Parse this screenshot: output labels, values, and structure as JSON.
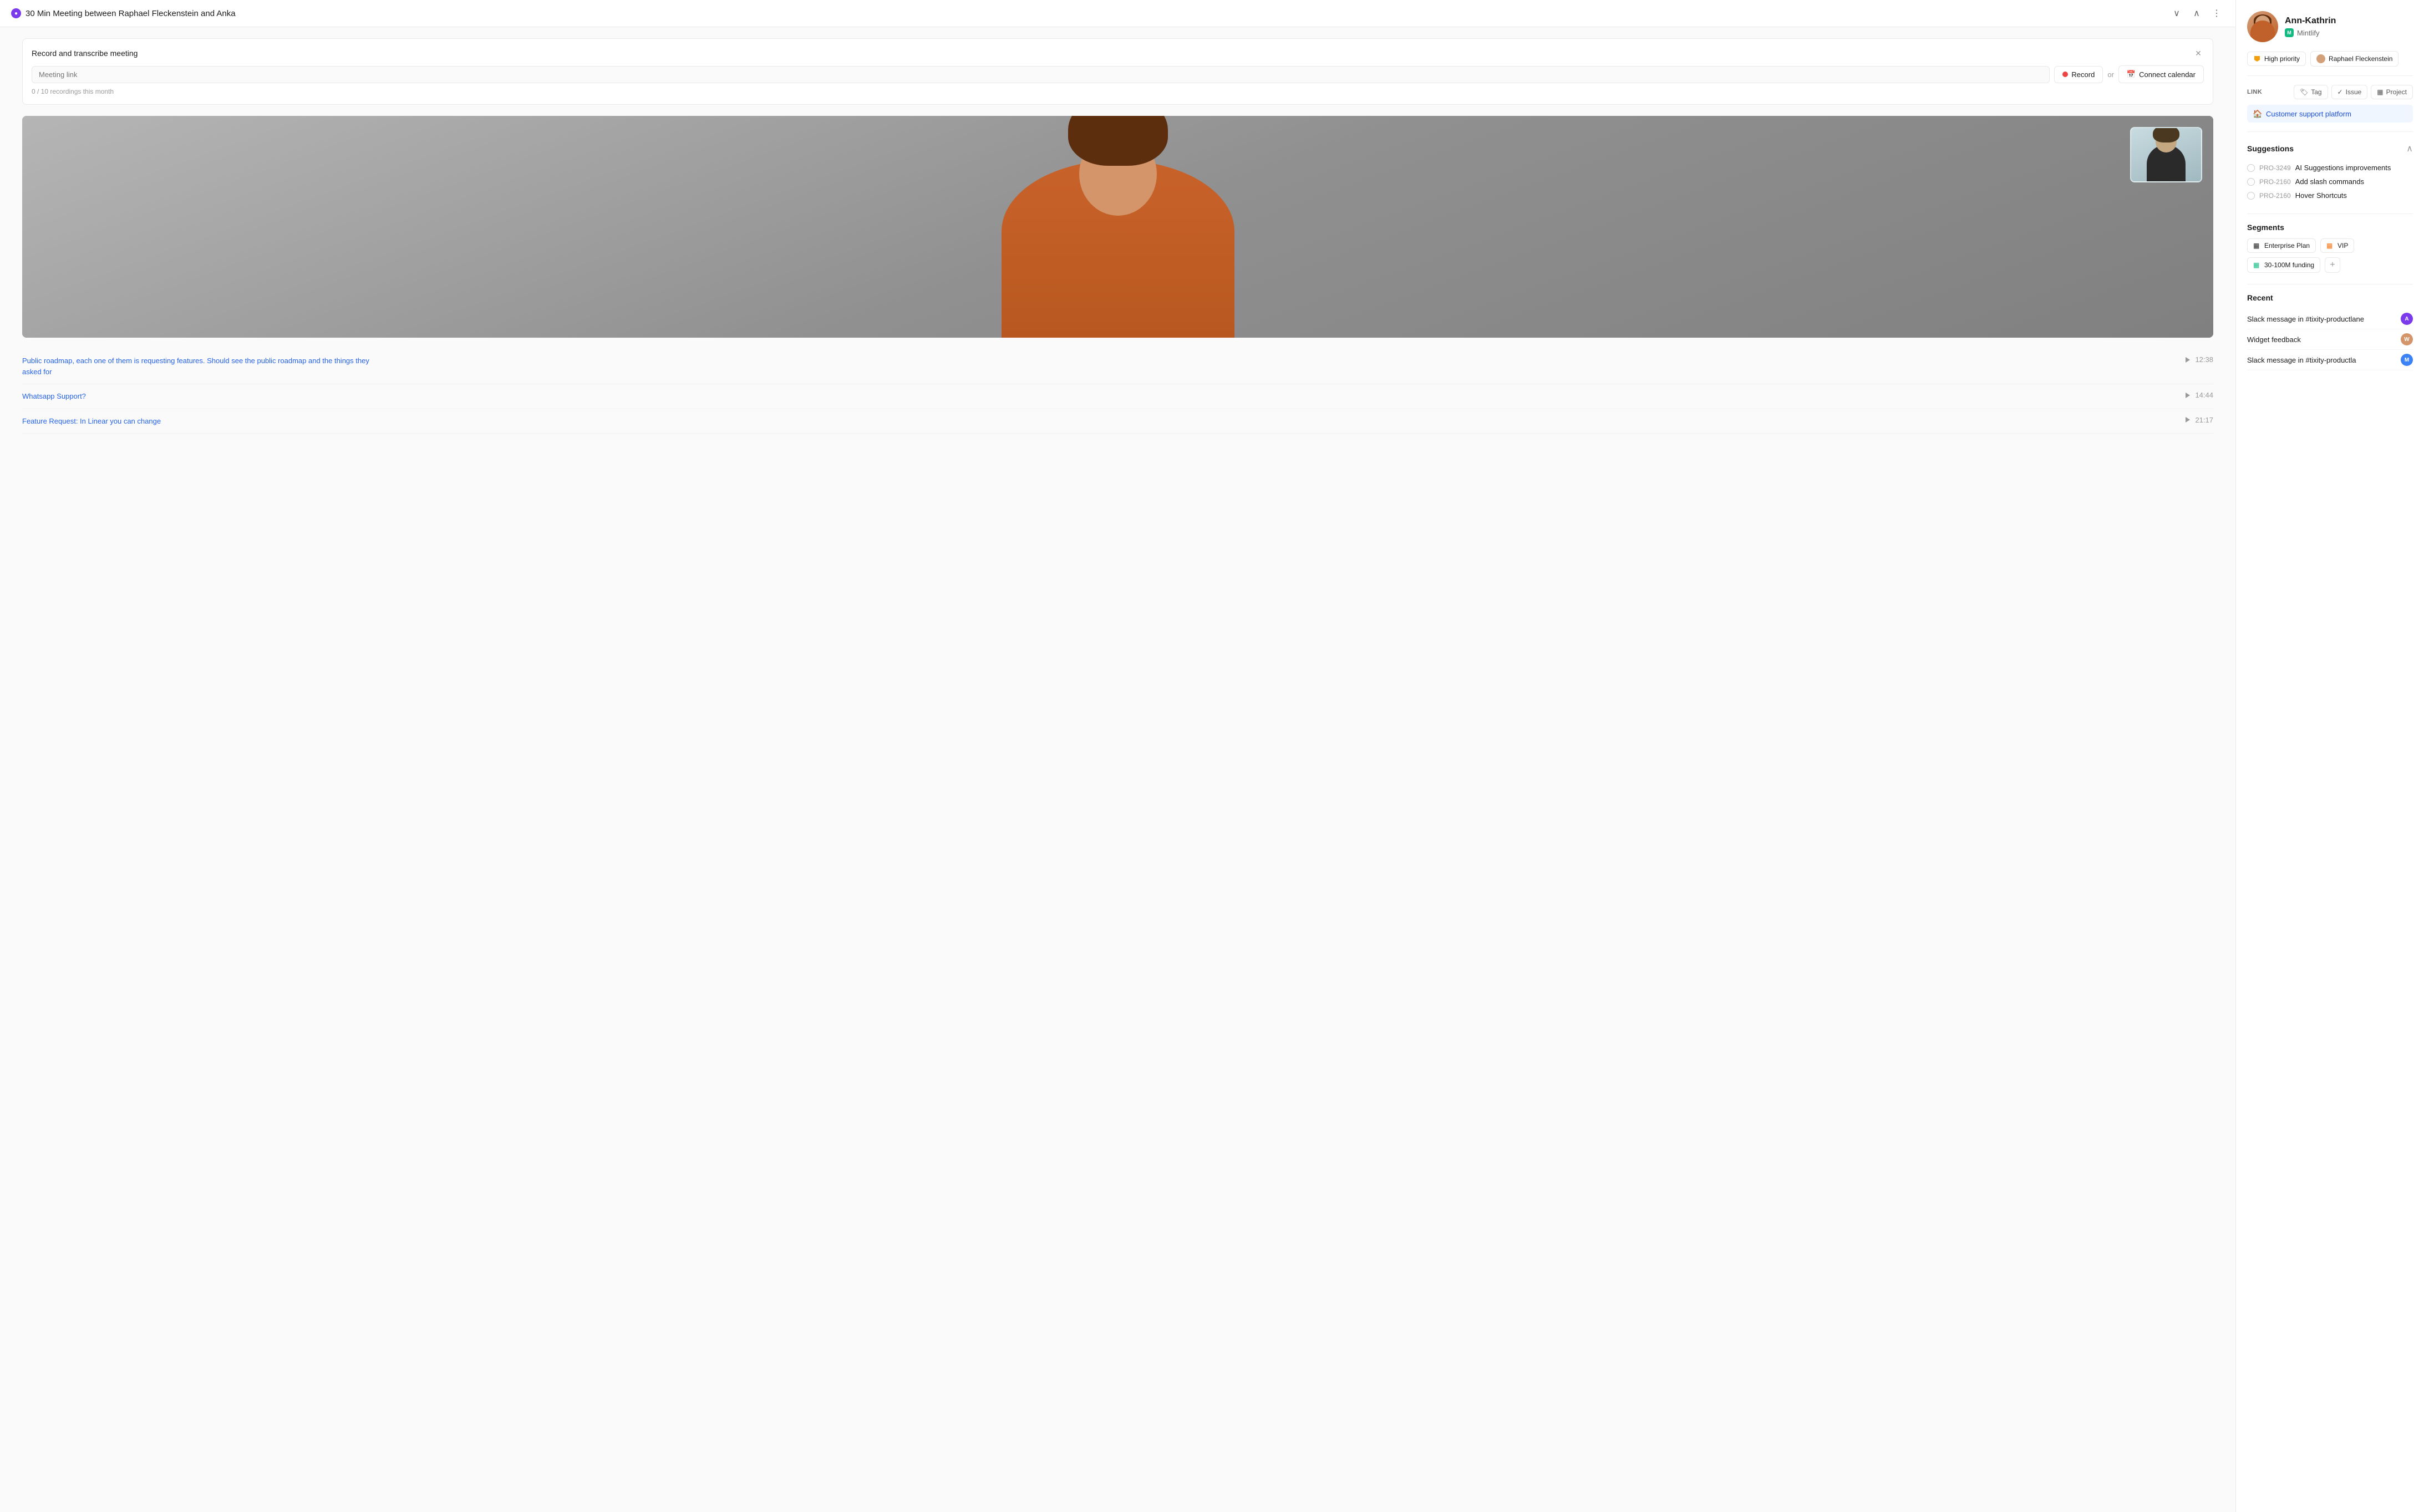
{
  "header": {
    "title": "30 Min Meeting between Raphael Fleckenstein and  Anka",
    "icon": "●",
    "collapse_label": "∨",
    "expand_label": "∧",
    "more_label": "⋮"
  },
  "record_card": {
    "title": "Record and transcribe meeting",
    "meeting_link_placeholder": "Meeting link",
    "record_label": "Record",
    "or_text": "or",
    "connect_calendar_label": "Connect calendar",
    "recordings_count": "0 / 10 recordings this month",
    "close_label": "✕"
  },
  "transcript": {
    "items": [
      {
        "text": "Public roadmap, each one of them is requesting features. Should see the public roadmap and the things they asked for",
        "time": "12:38"
      },
      {
        "text": "Whatsapp Support?",
        "time": "14:44"
      },
      {
        "text": "Feature Request: In Linear you can change",
        "time": "21:17"
      }
    ]
  },
  "sidebar": {
    "contact": {
      "name": "Ann-Kathrin",
      "company": "Mintlify"
    },
    "meta": {
      "priority_label": "High priority",
      "person_label": "Raphael Fleckenstein"
    },
    "link": {
      "section_title": "Link",
      "tag_label": "Tag",
      "issue_label": "Issue",
      "project_label": "Project",
      "linked_item": "Customer support platform"
    },
    "suggestions": {
      "title": "Suggestions",
      "items": [
        {
          "id": "PRO-3249",
          "text": "AI Suggestions improvements"
        },
        {
          "id": "PRO-2160",
          "text": "Add slash commands"
        },
        {
          "id": "PRO-2160",
          "text": "Hover Shortcuts"
        }
      ]
    },
    "segments": {
      "title": "Segments",
      "items": [
        {
          "label": "Enterprise Plan",
          "color": "#6b7280"
        },
        {
          "label": "VIP",
          "color": "#f97316"
        },
        {
          "label": "30-100M funding",
          "color": "#10b981"
        }
      ]
    },
    "recent": {
      "title": "Recent",
      "items": [
        {
          "text": "Slack message in #tixity-productlane",
          "avatar_bg": "#7c3aed",
          "avatar_letter": "A"
        },
        {
          "text": "Widget feedback",
          "avatar_bg": "#d4a07a",
          "avatar_letter": "W"
        },
        {
          "text": "Slack message in #tixity-productla",
          "avatar_bg": "#3b82f6",
          "avatar_letter": "M"
        }
      ]
    }
  },
  "colors": {
    "accent_blue": "#2563eb",
    "accent_green": "#10b981",
    "accent_purple": "#7c3aed",
    "priority_amber": "#f59e0b",
    "danger_red": "#ef4444"
  }
}
